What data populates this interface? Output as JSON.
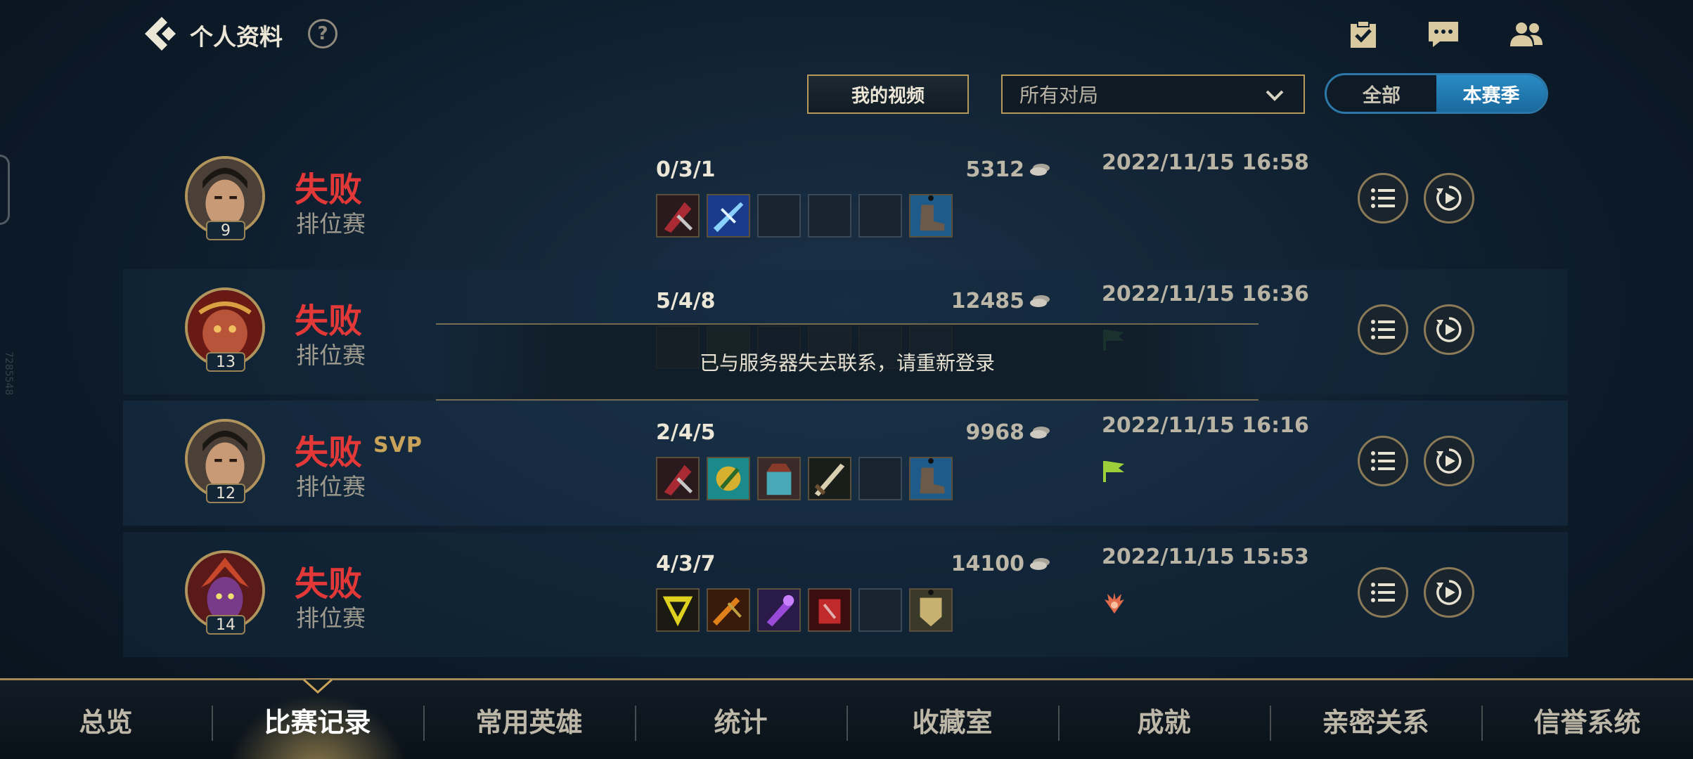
{
  "header": {
    "title": "个人资料",
    "help_label": "?",
    "icons": [
      "back-arrow-icon",
      "task-checklist-icon",
      "chat-bubble-icon",
      "friends-icon"
    ]
  },
  "filters": {
    "video_button": "我的视频",
    "match_filter_value": "所有对局",
    "season_toggle": {
      "options": [
        "全部",
        "本赛季"
      ],
      "selected": "本赛季"
    }
  },
  "side_id": "7285548",
  "matches": [
    {
      "level": "9",
      "result": "失败",
      "svp": "",
      "mode": "排位赛",
      "kda": "0/3/1",
      "gold": "5312",
      "time": "2022/11/15 16:58",
      "mark": ""
    },
    {
      "level": "13",
      "result": "失败",
      "svp": "",
      "mode": "排位赛",
      "kda": "5/4/8",
      "gold": "12485",
      "time": "2022/11/15 16:36",
      "mark": "flag"
    },
    {
      "level": "12",
      "result": "失败",
      "svp": "SVP",
      "mode": "排位赛",
      "kda": "2/4/5",
      "gold": "9968",
      "time": "2022/11/15 16:16",
      "mark": "flag"
    },
    {
      "level": "14",
      "result": "失败",
      "svp": "",
      "mode": "排位赛",
      "kda": "4/3/7",
      "gold": "14100",
      "time": "2022/11/15 15:53",
      "mark": "crest"
    }
  ],
  "toast": "已与服务器失去联系，请重新登录",
  "bottom_nav": {
    "tabs": [
      "总览",
      "比赛记录",
      "常用英雄",
      "统计",
      "收藏室",
      "成就",
      "亲密关系",
      "信誉系统"
    ],
    "active": "比赛记录"
  },
  "colors": {
    "loss": "#e33838",
    "gold_border": "#b59a5b",
    "accent_blue": "#2a8bc4"
  }
}
